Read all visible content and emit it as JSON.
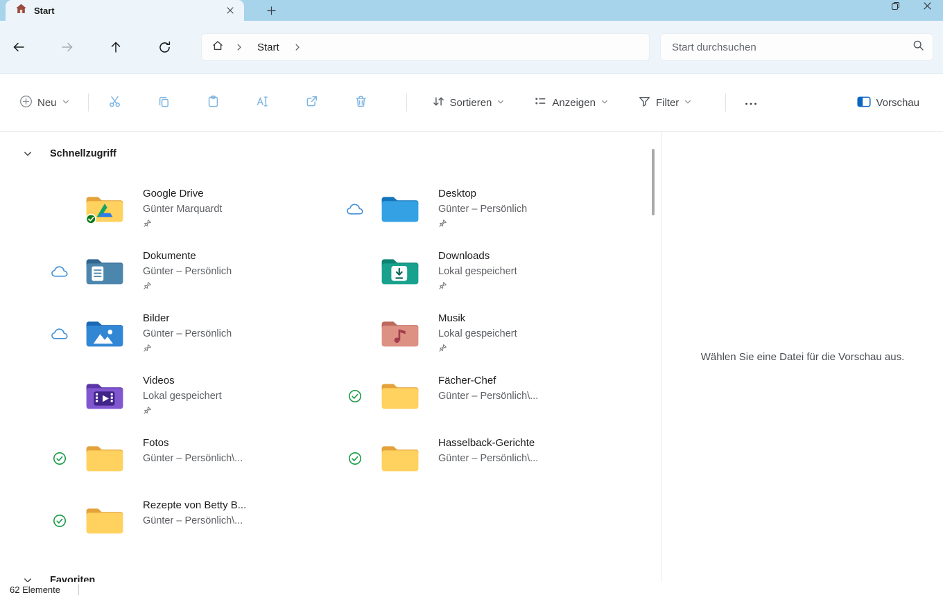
{
  "window": {
    "tab_title": "Start"
  },
  "nav": {
    "breadcrumb": {
      "items": [
        "Start"
      ]
    },
    "search": {
      "placeholder": "Start durchsuchen",
      "value": ""
    }
  },
  "toolbar": {
    "new_label": "Neu",
    "sort_label": "Sortieren",
    "view_label": "Anzeigen",
    "filter_label": "Filter",
    "preview_label": "Vorschau"
  },
  "content": {
    "section_title": "Schnellzugriff",
    "section2_title": "Favoriten",
    "items": [
      {
        "name": "Google Drive",
        "sub": "Günter Marquardt",
        "icon": "google-drive",
        "status": "none",
        "pinned": true
      },
      {
        "name": "Desktop",
        "sub": "Günter – Persönlich",
        "icon": "desktop-folder",
        "status": "cloud",
        "pinned": true
      },
      {
        "name": "Dokumente",
        "sub": "Günter – Persönlich",
        "icon": "documents-folder",
        "status": "cloud",
        "pinned": true
      },
      {
        "name": "Downloads",
        "sub": "Lokal gespeichert",
        "icon": "downloads-folder",
        "status": "none",
        "pinned": true
      },
      {
        "name": "Bilder",
        "sub": "Günter – Persönlich",
        "icon": "pictures-folder",
        "status": "cloud",
        "pinned": true
      },
      {
        "name": "Musik",
        "sub": "Lokal gespeichert",
        "icon": "music-folder",
        "status": "none",
        "pinned": true
      },
      {
        "name": "Videos",
        "sub": "Lokal gespeichert",
        "icon": "videos-folder",
        "status": "none",
        "pinned": true
      },
      {
        "name": "Fächer-Chef",
        "sub": "Günter – Persönlich\\...",
        "icon": "folder",
        "status": "check",
        "pinned": false
      },
      {
        "name": "Fotos",
        "sub": "Günter – Persönlich\\...",
        "icon": "folder",
        "status": "check",
        "pinned": false
      },
      {
        "name": "Hasselback-Gerichte",
        "sub": "Günter – Persönlich\\...",
        "icon": "folder",
        "status": "check",
        "pinned": false
      },
      {
        "name": "Rezepte von Betty B...",
        "sub": "Günter – Persönlich\\...",
        "icon": "folder",
        "status": "check",
        "pinned": false
      }
    ]
  },
  "preview": {
    "empty_text": "Wählen Sie eine Datei für die Vorschau aus."
  },
  "statusbar": {
    "items_count": "62 Elemente"
  },
  "colors": {
    "accent": "#0a66c2",
    "sync_green": "#189a46",
    "cloud_blue": "#4190d6",
    "tabbar_blue": "#a7d3eb"
  }
}
